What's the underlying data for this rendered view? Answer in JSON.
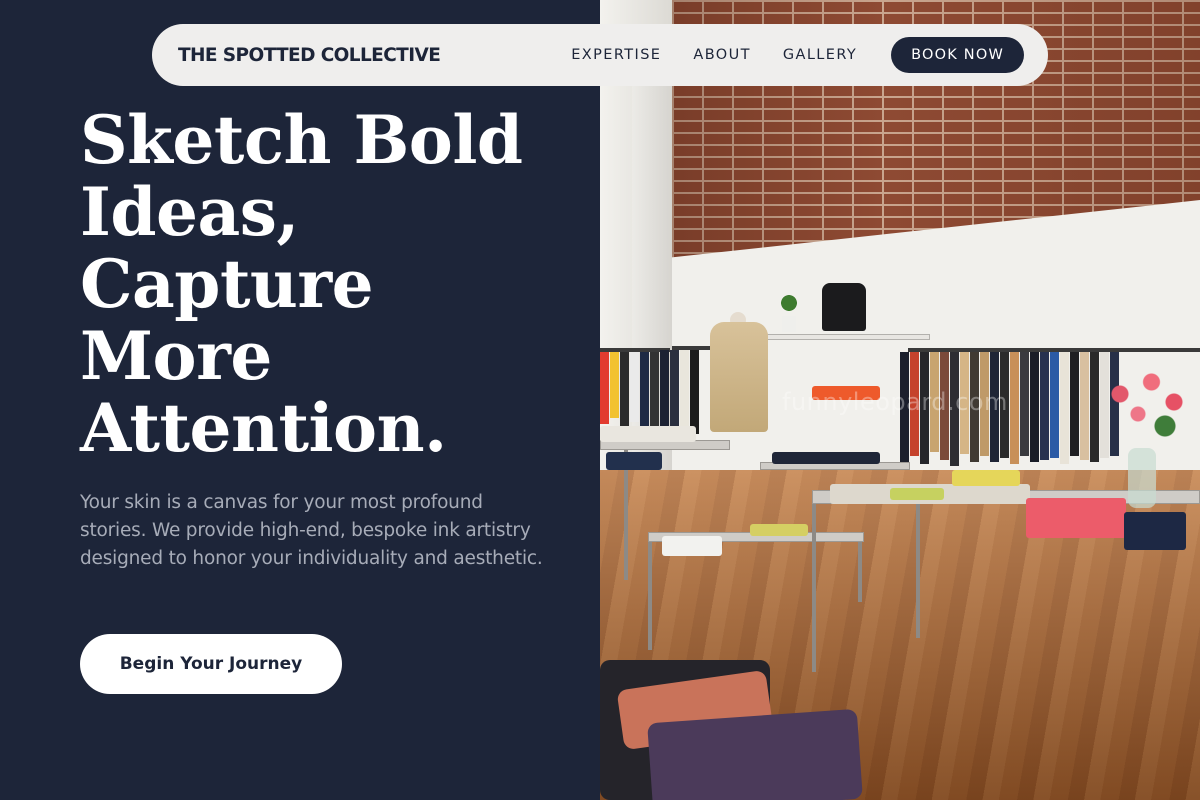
{
  "header": {
    "brand": "THE SPOTTED COLLECTIVE",
    "nav_items": [
      {
        "label": "EXPERTISE"
      },
      {
        "label": "ABOUT"
      },
      {
        "label": "GALLERY"
      }
    ],
    "book_label": "BOOK NOW"
  },
  "hero": {
    "headline_lines": [
      "Sketch Bold",
      "Ideas,",
      "Capture",
      "More",
      "Attention."
    ],
    "intro": "Your skin is a canvas for your most profound stories. We provide high-end, bespoke ink artistry designed to honor your individuality and aesthetic.",
    "cta_label": "Begin Your Journey"
  },
  "image": {
    "subject": "clothing-store-interior",
    "watermark": "funnyleopard.com"
  },
  "colors": {
    "navy": "#1d2539",
    "nav_bg": "#efeeed",
    "white": "#ffffff",
    "muted_text": "#a7acb8"
  }
}
